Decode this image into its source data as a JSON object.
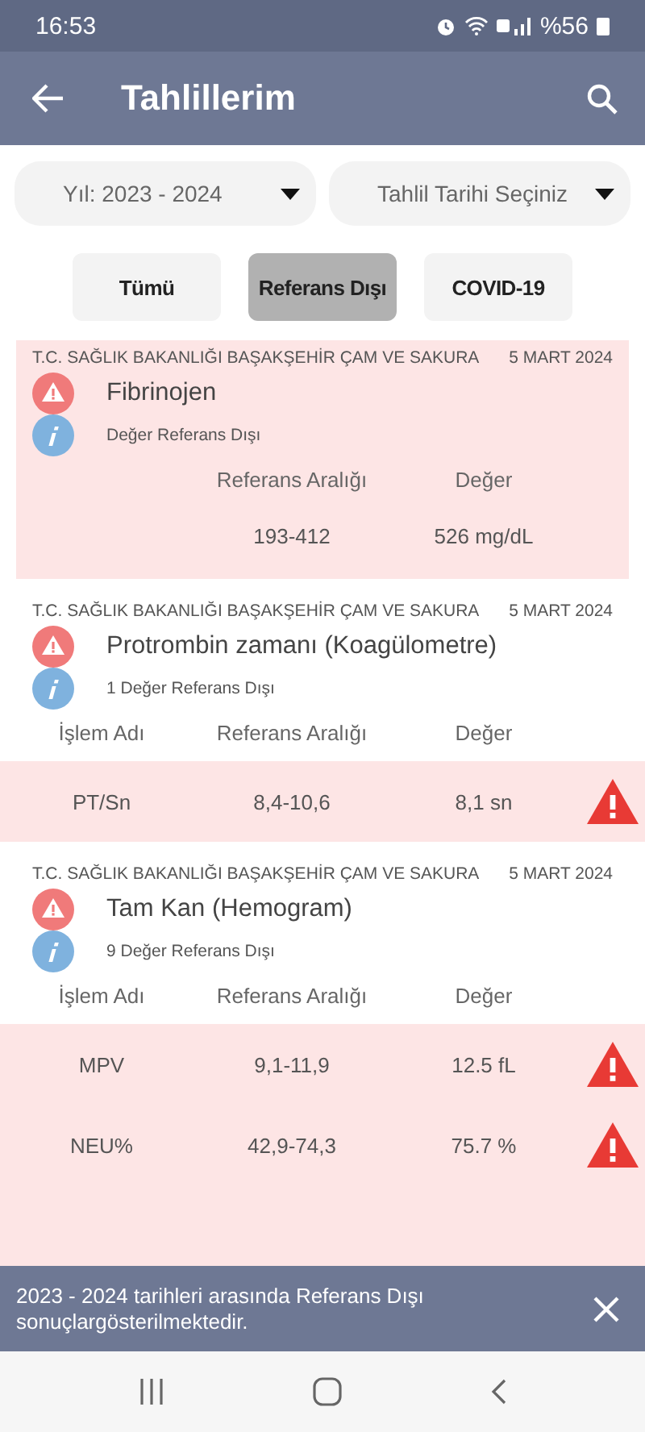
{
  "status_bar": {
    "time": "16:53",
    "battery": "%56"
  },
  "app_bar": {
    "title": "Tahlillerim"
  },
  "filters": [
    {
      "value": "Yıl: 2023 - 2024"
    },
    {
      "value": "Tahlil Tarihi Seçiniz"
    }
  ],
  "chips": [
    {
      "label": "Tümü",
      "selected": false
    },
    {
      "label": "Referans Dışı",
      "selected": true
    },
    {
      "label": "COVID-19",
      "selected": false
    }
  ],
  "results": [
    {
      "kind": "single",
      "hospital": "T.C. SAĞLIK BAKANLIĞI BAŞAKŞEHİR ÇAM VE SAKURA",
      "date": "5 MART 2024",
      "test": "Fibrinojen",
      "summary": "Değer Referans Dışı",
      "columns": [
        "Referans Aralığı",
        "Değer"
      ],
      "rows": [
        {
          "cells": [
            "193-412",
            "526 mg/dL"
          ]
        }
      ]
    },
    {
      "kind": "table",
      "hospital": "T.C. SAĞLIK BAKANLIĞI BAŞAKŞEHİR ÇAM VE SAKURA",
      "date": "5 MART 2024",
      "test": "Protrombin zamanı (Koagülometre)",
      "summary": "1 Değer Referans Dışı",
      "columns": [
        "İşlem Adı",
        "Referans Aralığı",
        "Değer"
      ],
      "rows": [
        {
          "cells": [
            "PT/Sn",
            "8,4-10,6",
            "8,1 sn"
          ],
          "flagged": true
        }
      ]
    },
    {
      "kind": "table",
      "hospital": "T.C. SAĞLIK BAKANLIĞI BAŞAKŞEHİR ÇAM VE SAKURA",
      "date": "5 MART 2024",
      "test": "Tam Kan (Hemogram)",
      "summary": "9 Değer Referans Dışı",
      "columns": [
        "İşlem Adı",
        "Referans Aralığı",
        "Değer"
      ],
      "rows": [
        {
          "cells": [
            "MPV",
            "9,1-11,9",
            "12.5 fL"
          ],
          "flagged": true
        },
        {
          "cells": [
            "NEU%",
            "42,9-74,3",
            "75.7 %"
          ],
          "flagged": true
        }
      ]
    }
  ],
  "snackbar": {
    "message": "2023 - 2024 tarihleri arasında Referans Dışı sonuçlargösterilmektedir."
  }
}
